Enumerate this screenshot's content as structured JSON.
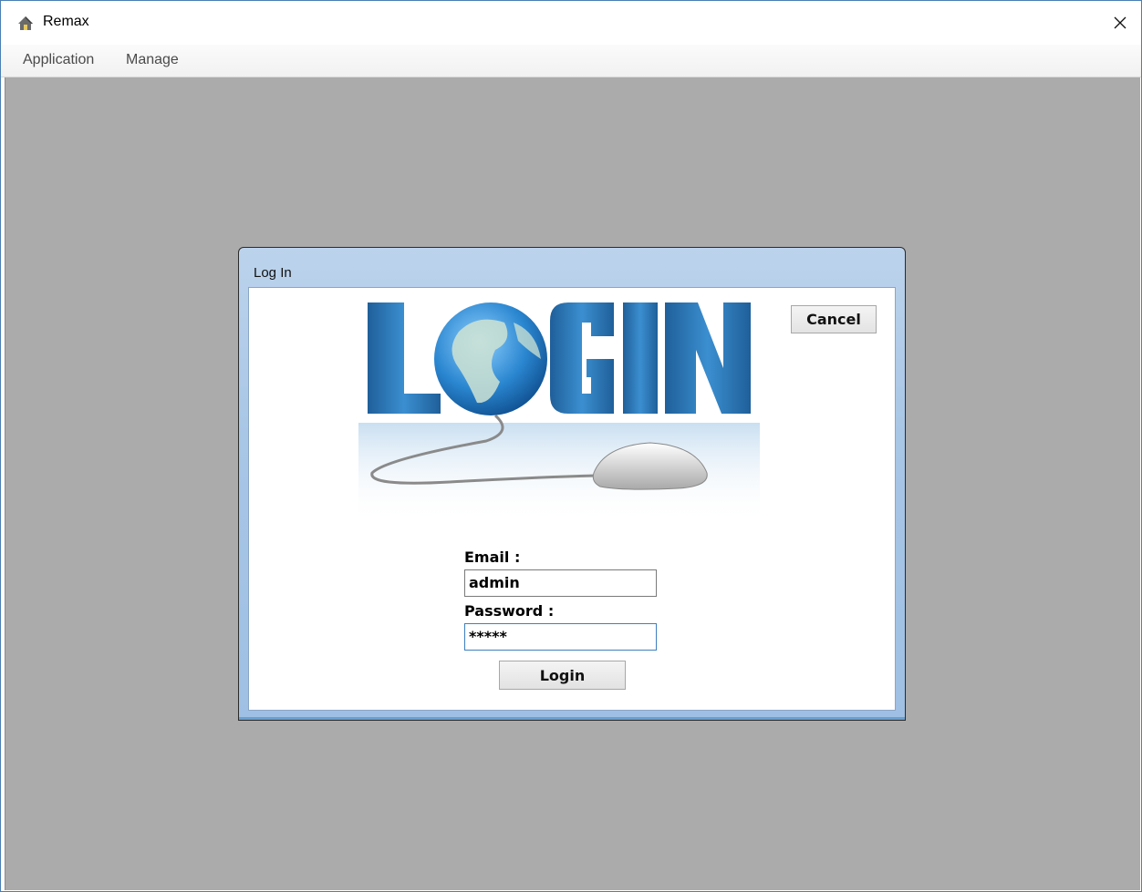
{
  "window": {
    "title": "Remax",
    "icon": "house-icon",
    "close_icon": "close-icon"
  },
  "menu": {
    "items": [
      {
        "label": "Application"
      },
      {
        "label": "Manage"
      }
    ]
  },
  "dialog": {
    "title": "Log In",
    "logo_text": "LOGIN",
    "cancel_label": "Cancel",
    "email_label": "Email :",
    "email_value": "admin",
    "password_label": "Password :",
    "password_value": "*****",
    "login_label": "Login"
  },
  "colors": {
    "desktop_bg": "#ababab",
    "logo_blue": "#2f7cc0",
    "dialog_frame": "#a8c6e6"
  }
}
